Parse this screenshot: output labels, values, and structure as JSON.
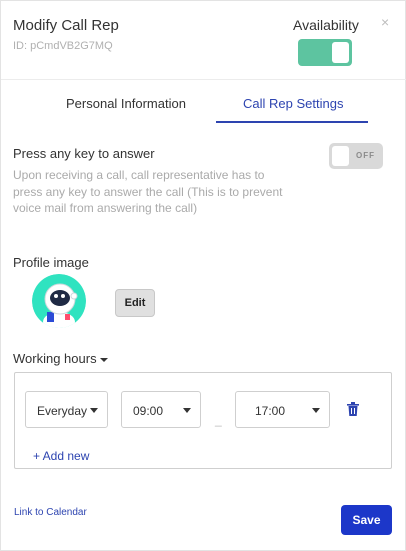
{
  "header": {
    "title": "Modify Call Rep",
    "id_text": "ID: pCmdVB2G7MQ",
    "availability_label": "Availability",
    "availability_on": true,
    "close_icon": "close-icon"
  },
  "tabs": [
    {
      "label": "Personal Information",
      "active": false
    },
    {
      "label": "Call Rep Settings",
      "active": true
    }
  ],
  "press_any_key": {
    "title": "Press any key to answer",
    "description": "Upon receiving a call, call representative has to press any key to answer the call (This is to prevent voice mail from answering the call)",
    "toggle_text": "OFF",
    "enabled": false
  },
  "profile_image": {
    "title": "Profile image",
    "edit_label": "Edit"
  },
  "working_hours": {
    "title": "Working hours",
    "rows": [
      {
        "day": "Everyday",
        "start": "09:00",
        "end": "17:00"
      }
    ],
    "add_new_label": "+ Add new",
    "separator": "_"
  },
  "footer": {
    "link_calendar": "Link to Calendar",
    "save_label": "Save"
  },
  "colors": {
    "accent": "#2d44b0",
    "save_button": "#1c37c9",
    "availability_toggle": "#5dc4a0"
  }
}
